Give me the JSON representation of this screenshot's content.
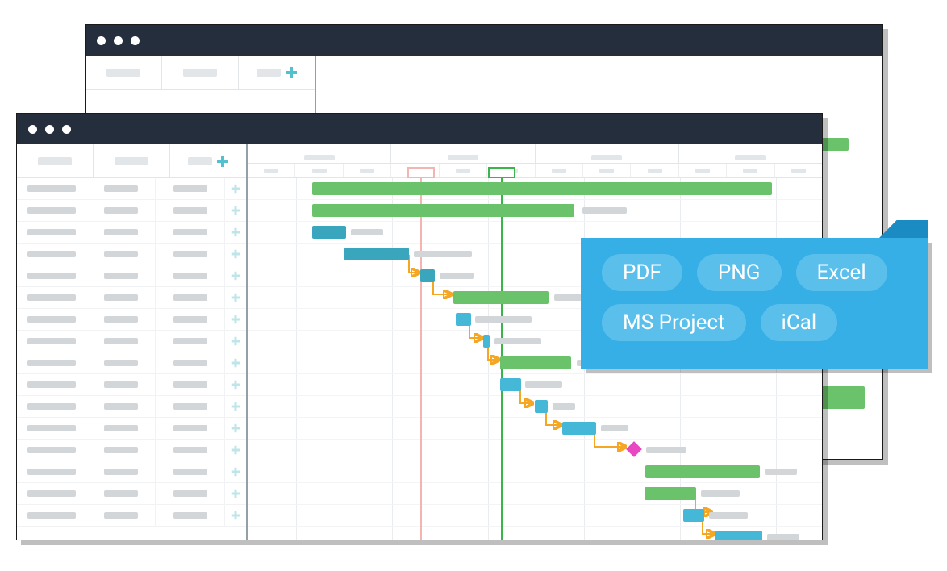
{
  "windows": {
    "back": {
      "title_dots": 3
    },
    "front": {
      "title_dots": 3
    }
  },
  "left_panel": {
    "columns": 3,
    "add_column_label": "",
    "task_rows": 15
  },
  "timeline": {
    "top_segments": 4,
    "day_cells": 12,
    "markers": {
      "red": {
        "label": ""
      },
      "green": {
        "label": ""
      }
    }
  },
  "export_options": {
    "pdf": "PDF",
    "png": "PNG",
    "excel": "Excel",
    "msproject": "MS Project",
    "ical": "iCal"
  },
  "colors": {
    "titlebar": "#242e3c",
    "green_bar": "#6ac26a",
    "teal_bar": "#3aa6bd",
    "cyan_bar": "#44b8d6",
    "accent_cyan": "#52c0cd",
    "popover": "#36aee6",
    "pill": "#5bbfec",
    "milestone": "#e948c2",
    "dependency": "#f5a623",
    "marker_red": "#f4b5b0",
    "marker_green": "#3ab54a"
  }
}
